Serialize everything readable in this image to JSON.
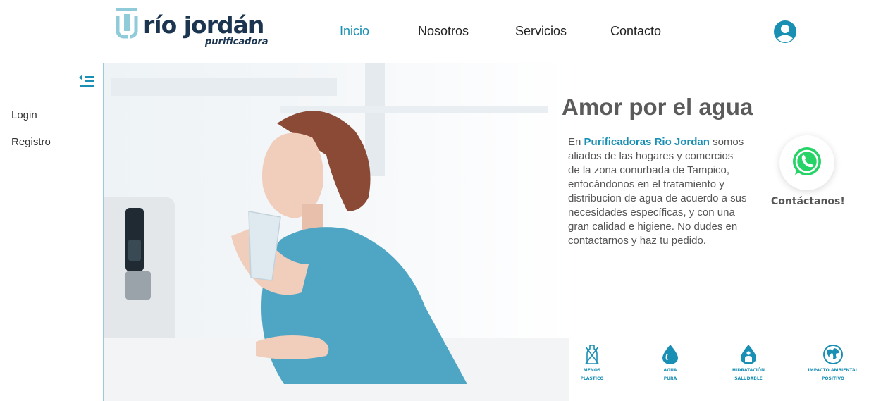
{
  "brand": {
    "name": "río jordán",
    "subtitle": "purificadora",
    "colors": {
      "primary": "#1a8fb4",
      "dark": "#1b3450",
      "whatsapp": "#25d366"
    }
  },
  "nav": {
    "items": [
      {
        "label": "Inicio",
        "active": true
      },
      {
        "label": "Nosotros",
        "active": false
      },
      {
        "label": "Servicios",
        "active": false
      },
      {
        "label": "Contacto",
        "active": false
      }
    ],
    "user_icon": "user-circle-icon"
  },
  "sidebar": {
    "toggle_icon": "collapse-menu-icon",
    "links": [
      {
        "label": "Login"
      },
      {
        "label": "Registro"
      }
    ]
  },
  "hero": {
    "headline": "Amor por el agua",
    "intro": "En",
    "brand_highlight": "Purificadoras Rio Jordan",
    "body": "somos aliados de las hogares y comercios de la zona conurbada de Tampico, enfocándonos en el tratamiento y distribucion de agua de acuerdo a sus necesidades específicas, y con una gran calidad e higiene. No dudes en contactarnos y haz tu pedido."
  },
  "whatsapp": {
    "icon": "whatsapp-icon",
    "label": "Contáctanos!"
  },
  "features": [
    {
      "icon": "no-plastic-bottle-icon",
      "line1": "MENOS",
      "line2": "PLÁSTICO"
    },
    {
      "icon": "water-drop-icon",
      "line1": "AGUA",
      "line2": "PURA"
    },
    {
      "icon": "healthy-hydration-icon",
      "line1": "HIDRATACIÓN",
      "line2": "SALUDABLE"
    },
    {
      "icon": "globe-icon",
      "line1": "IMPACTO AMBIENTAL",
      "line2": "POSITIVO"
    }
  ]
}
